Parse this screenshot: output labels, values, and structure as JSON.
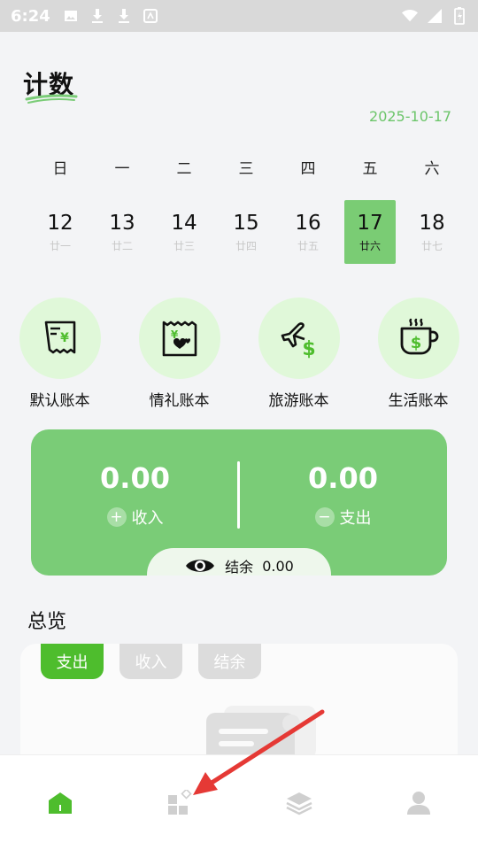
{
  "status_bar": {
    "time": "6:24"
  },
  "header": {
    "title": "计数",
    "today": "2025-10-17"
  },
  "week": {
    "weekdays": [
      "日",
      "一",
      "二",
      "三",
      "四",
      "五",
      "六"
    ],
    "days": [
      {
        "num": "12",
        "lunar": "廿一"
      },
      {
        "num": "13",
        "lunar": "廿二"
      },
      {
        "num": "14",
        "lunar": "廿三"
      },
      {
        "num": "15",
        "lunar": "廿四"
      },
      {
        "num": "16",
        "lunar": "廿五"
      },
      {
        "num": "17",
        "lunar": "廿六"
      },
      {
        "num": "18",
        "lunar": "廿七"
      }
    ],
    "selected_day": "17"
  },
  "books": [
    {
      "label": "默认账本",
      "icon": "receipt-yen-icon"
    },
    {
      "label": "情礼账本",
      "icon": "gift-receipt-icon"
    },
    {
      "label": "旅游账本",
      "icon": "plane-dollar-icon"
    },
    {
      "label": "生活账本",
      "icon": "cup-dollar-icon"
    }
  ],
  "summary": {
    "income_value": "0.00",
    "income_label": "收入",
    "income_sign": "+",
    "expense_value": "0.00",
    "expense_label": "支出",
    "expense_sign": "−",
    "balance_label": "结余",
    "balance_value": "0.00"
  },
  "overview": {
    "title": "总览",
    "tabs": [
      "支出",
      "收入",
      "结余"
    ],
    "active_tab": "支出"
  },
  "nav": [
    "home-icon",
    "apps-icon",
    "layers-icon",
    "profile-icon"
  ],
  "colors": {
    "accent": "#7acc77",
    "active_green": "#4ebd2d",
    "date_green": "#6cc56a",
    "circle_bg": "#e0f8d9",
    "arrow": "#e53935"
  }
}
